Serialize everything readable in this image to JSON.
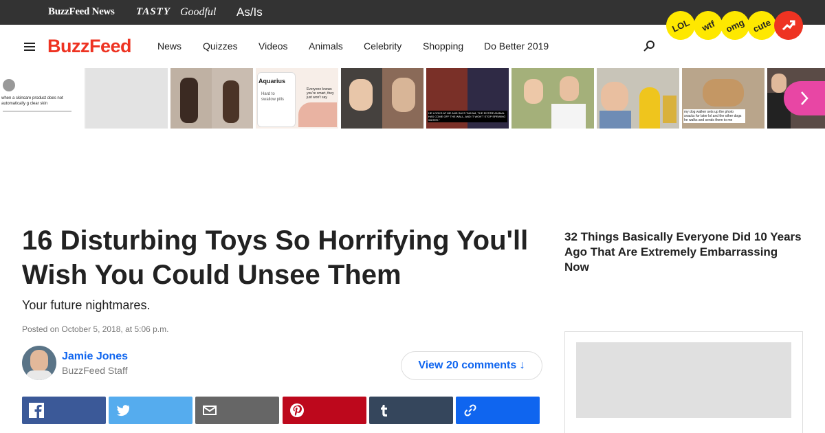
{
  "brands": [
    "BuzzFeed News",
    "TASTY",
    "Goodful",
    "As/Is"
  ],
  "nav": {
    "logo": "BuzzFeed",
    "items": [
      "News",
      "Quizzes",
      "Videos",
      "Animals",
      "Celebrity",
      "Shopping",
      "Do Better 2019"
    ],
    "badges": [
      "LOL",
      "wtf",
      "omg",
      "cute"
    ]
  },
  "strip": {
    "thumb1_caption": "when a skincare product does not automatically g clear skin",
    "thumb4_title": "Aquarius",
    "thumb4_sub": "Hard to swallow pills",
    "thumb4_note": "Everyone knows you're smart, they just won't say",
    "thumb6_caption": "HE LOOKS AT ME AND SAYS \"MA'AM, THE ENTIRE ANIMAL HAS COME OFF THE WALL, AND IT WON'T STOP SPEWING WATER.\"",
    "thumb9_caption": "my dog walker sets up the photo snacks for later lol and the other dogs he walks and sends them to me"
  },
  "article": {
    "headline": "16 Disturbing Toys So Horrifying You'll Wish You Could Unsee Them",
    "subhead": "Your future nightmares.",
    "posted": "Posted on October 5, 2018, at 5:06 p.m.",
    "author": "Jamie Jones",
    "role": "BuzzFeed Staff",
    "comments": "View 20 comments ↓"
  },
  "share_colors": {
    "facebook": "#3b5998",
    "twitter": "#55acee",
    "email": "#666666",
    "pinterest": "#bd081c",
    "tumblr": "#35465c",
    "link": "#0f65ef"
  },
  "sidebar": {
    "title": "32 Things Basically Everyone Did 10 Years Ago That Are Extremely Embarrassing Now"
  }
}
